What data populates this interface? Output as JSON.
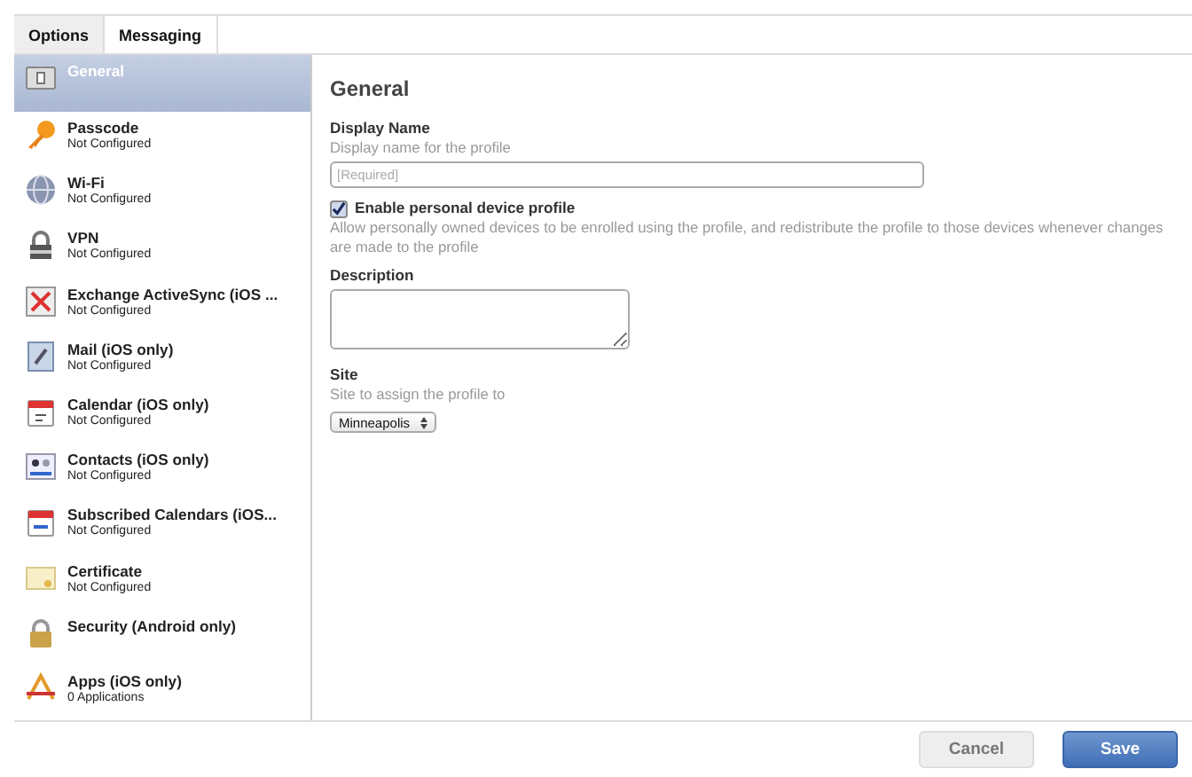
{
  "tabs": [
    {
      "label": "Options",
      "selected": true
    },
    {
      "label": "Messaging",
      "selected": false
    }
  ],
  "sidebar": {
    "items": [
      {
        "name": "General",
        "selected": true
      },
      {
        "name": "Passcode",
        "status": "Not Configured",
        "selected": false
      },
      {
        "name": "Wi-Fi",
        "status": "Not Configured",
        "selected": false
      },
      {
        "name": "VPN",
        "status": "Not Configured",
        "selected": false
      },
      {
        "name": "Exchange ActiveSync (iOS ...",
        "status": "Not Configured",
        "selected": false
      },
      {
        "name": "Mail (iOS only)",
        "status": "Not Configured",
        "selected": false
      },
      {
        "name": "Calendar (iOS only)",
        "status": "Not Configured",
        "selected": false
      },
      {
        "name": "Contacts (iOS only)",
        "status": "Not Configured",
        "selected": false
      },
      {
        "name": "Subscribed Calendars (iOS...",
        "status": "Not Configured",
        "selected": false
      },
      {
        "name": "Certificate",
        "status": "Not Configured",
        "selected": false
      },
      {
        "name": "Security (Android only)",
        "selected": false
      },
      {
        "name": "Apps (iOS only)",
        "status": "0 Applications",
        "selected": false
      }
    ]
  },
  "panel": {
    "title": "General",
    "display_name": {
      "label": "Display Name",
      "hint": "Display name for the profile",
      "placeholder": "[Required]"
    },
    "personal_profile": {
      "label": "Enable personal device profile",
      "checked": true,
      "hint": "Allow personally owned devices to be enrolled using the profile, and redistribute the profile to those devices whenever changes are made to the profile"
    },
    "description": {
      "label": "Description"
    },
    "site": {
      "label": "Site",
      "hint": "Site to assign the profile to",
      "value": "Minneapolis"
    }
  },
  "buttons": [
    {
      "label": "Cancel",
      "kind": "secondary"
    },
    {
      "label": "Save",
      "kind": "primary"
    }
  ]
}
